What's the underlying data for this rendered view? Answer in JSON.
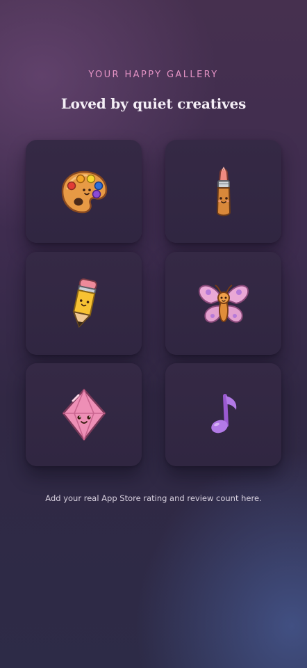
{
  "gallery": {
    "eyebrow": "YOUR HAPPY GALLERY",
    "headline": "Loved by quiet creatives",
    "tiles": [
      {
        "icon": "palette-icon"
      },
      {
        "icon": "paintbrush-icon"
      },
      {
        "icon": "pencil-icon"
      },
      {
        "icon": "butterfly-icon"
      },
      {
        "icon": "gem-icon"
      },
      {
        "icon": "music-note-icon"
      }
    ]
  },
  "footer": {
    "note": "Add your real App Store rating and review count here."
  },
  "colors": {
    "eyebrow": "#e493c5",
    "headline": "#f4eef6",
    "tile": "#332843",
    "footer_text": "#d8d1df"
  }
}
